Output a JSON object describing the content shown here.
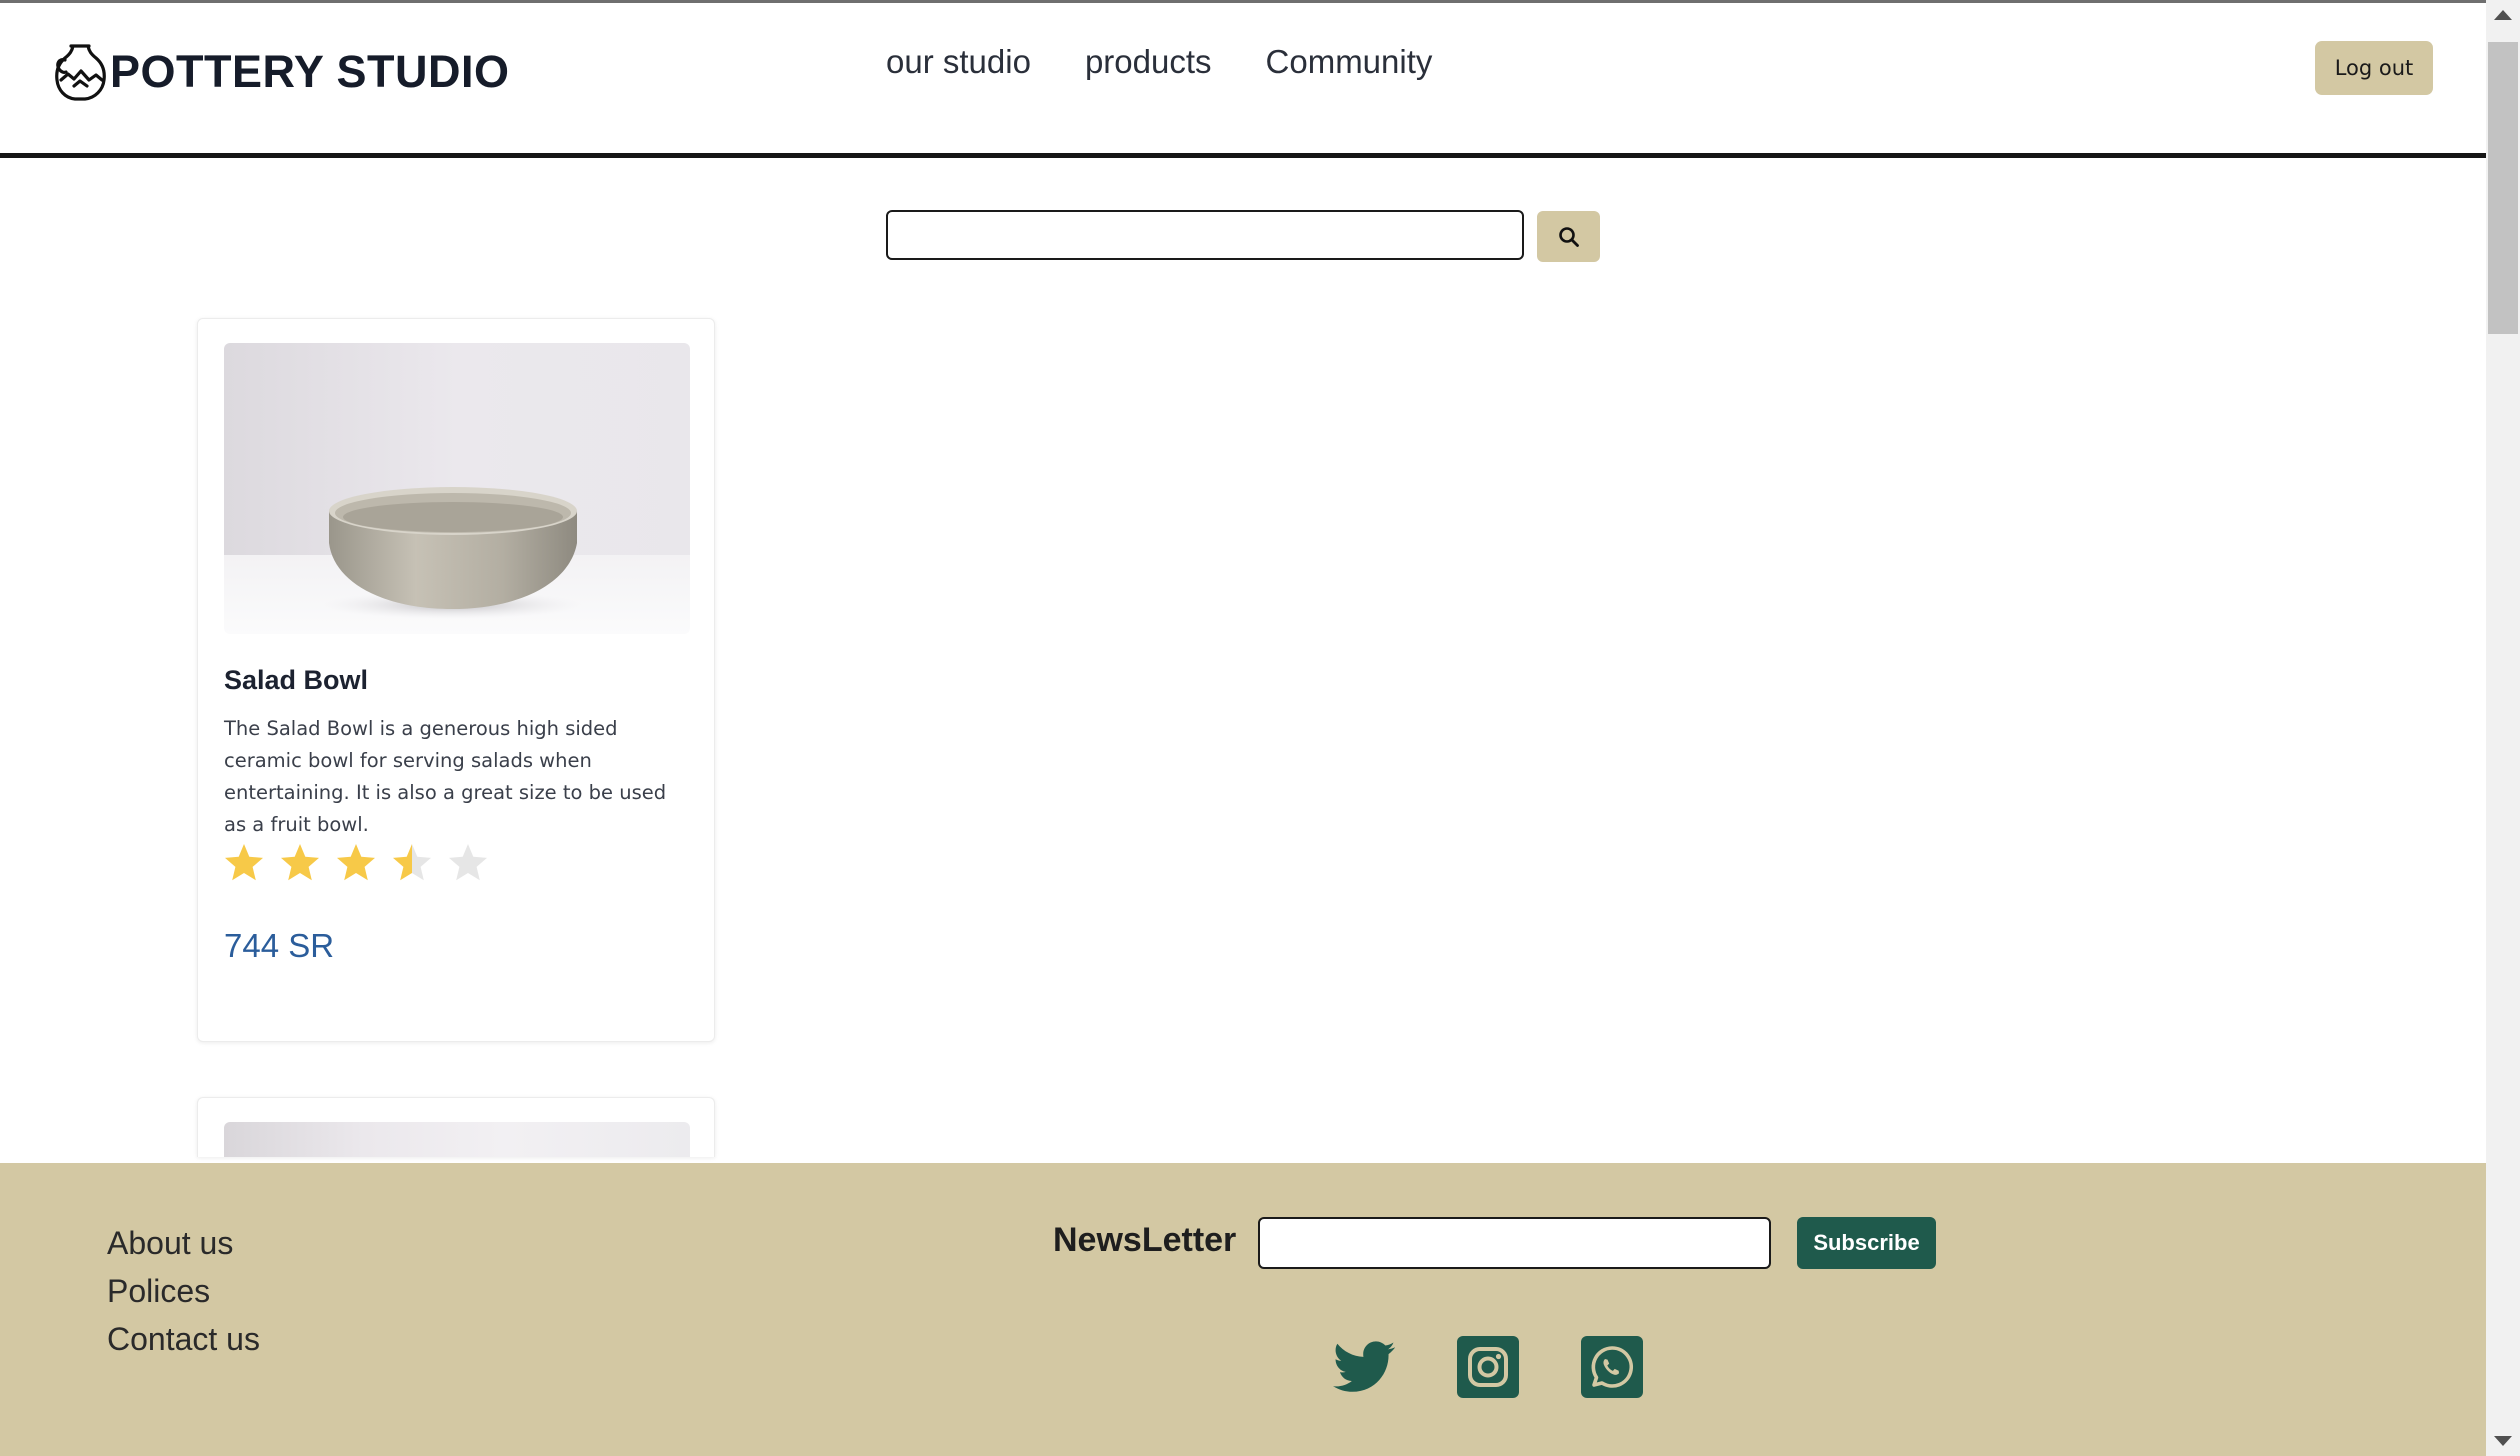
{
  "header": {
    "brand": "POTTERY STUDIO",
    "brand_icon": "vase-icon",
    "nav": [
      "our studio",
      "products",
      "Community"
    ],
    "logout_label": "Log out"
  },
  "search": {
    "value": "",
    "placeholder": "",
    "button_icon": "search-icon"
  },
  "products": [
    {
      "title": "Salad Bowl",
      "description": "The Salad Bowl is a generous high sided ceramic bowl for serving salads when entertaining. It is also a great size to be used as a fruit bowl.",
      "rating": 3.5,
      "rating_max": 5,
      "price": "744 SR"
    }
  ],
  "footer": {
    "links": [
      "About us",
      "Polices",
      "Contact us"
    ],
    "newsletter_label": "NewsLetter",
    "newsletter_value": "",
    "subscribe_label": "Subscribe",
    "socials": [
      "twitter-icon",
      "instagram-icon",
      "whatsapp-icon"
    ]
  },
  "colors": {
    "accent_tan": "#d3c8a3",
    "footer_green": "#1f5a4c",
    "star_gold": "#f7c948",
    "price_blue": "#2b5d9b"
  }
}
